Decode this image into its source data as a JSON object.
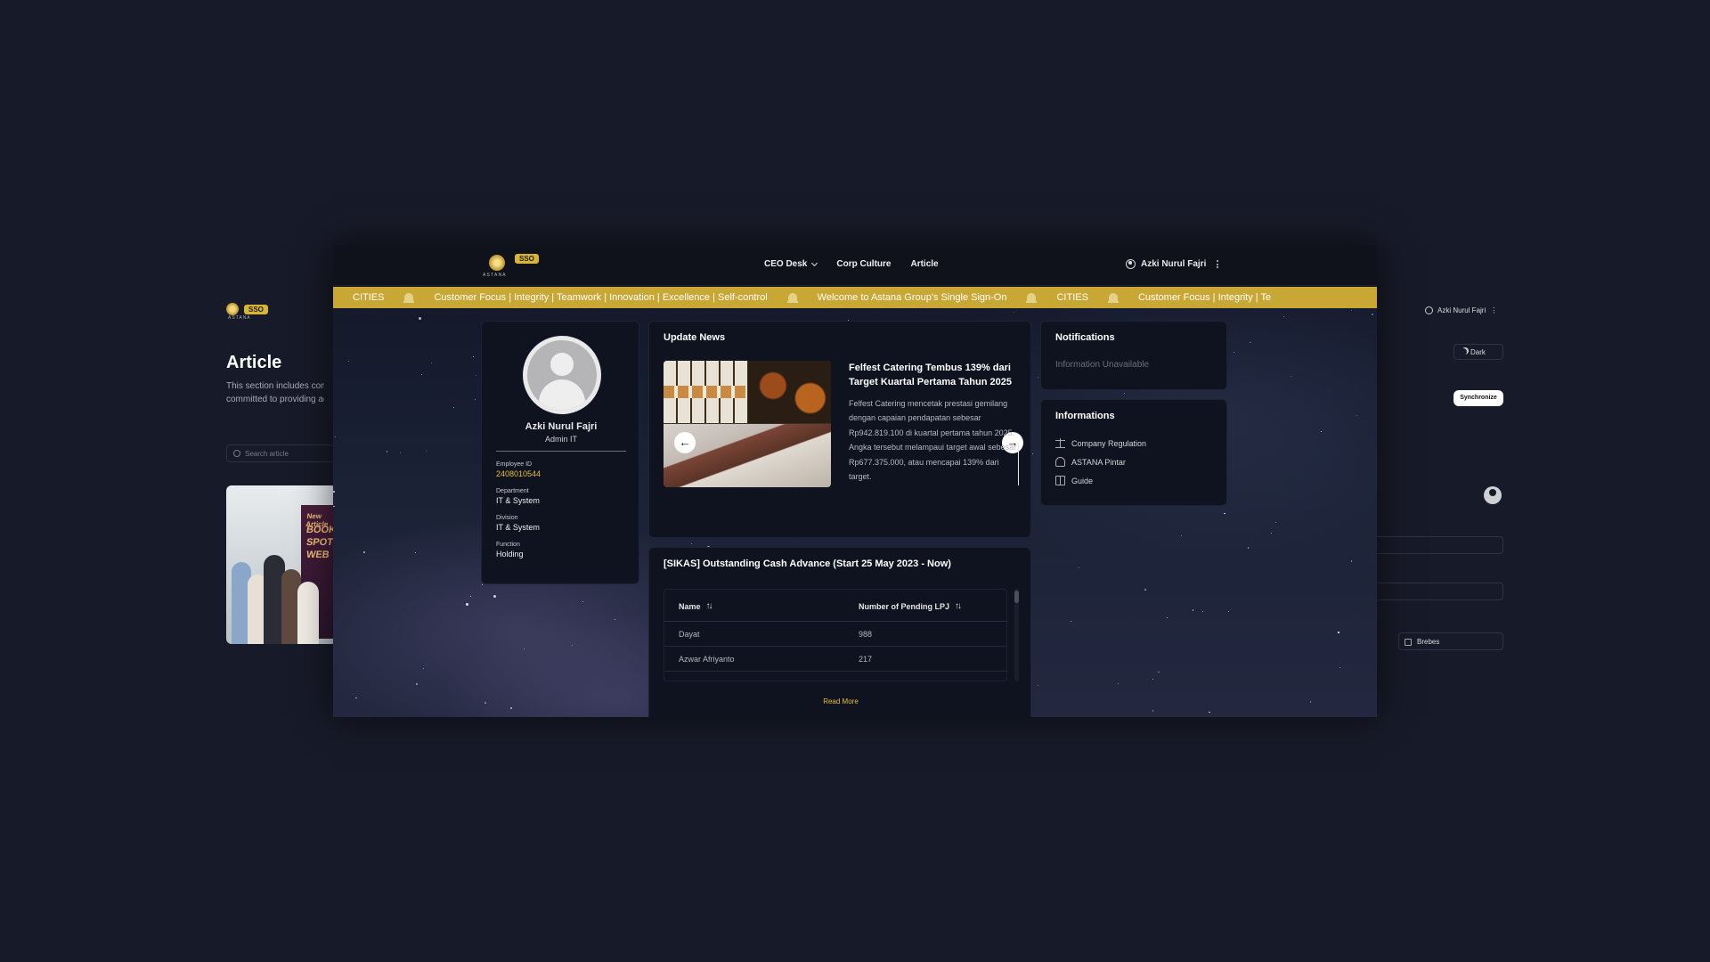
{
  "background_page": {
    "sso_badge": "SSO",
    "logo_text": "ASTANA",
    "title": "Article",
    "description_line1": "This section includes comp",
    "description_line2": "committed to providing ac",
    "search_placeholder": "Search article",
    "poster_words": [
      "New Article",
      "BOOK",
      "SPOT",
      "WEB"
    ],
    "user_name": "Azki Nurul Fajri",
    "theme_label": "Dark",
    "sync_label": "Synchronize",
    "location_label": "Brebes"
  },
  "app": {
    "logo_text": "ASTANA",
    "sso_badge": "SSO",
    "nav": [
      {
        "label": "CEO Desk",
        "has_dropdown": true
      },
      {
        "label": "Corp Culture"
      },
      {
        "label": "Article"
      }
    ],
    "user_name": "Azki Nurul Fajri"
  },
  "ticker": {
    "segments": [
      "CITIES",
      "Customer Focus | Integrity | Teamwork | Innovation | Excellence | Self-control",
      "Welcome to Astana Group's Single Sign-On",
      "CITIES",
      "Customer Focus | Integrity | Te"
    ],
    "bg_color": "#c9a735"
  },
  "profile": {
    "name": "Azki Nurul Fajri",
    "role": "Admin IT",
    "employee_id_label": "Employee ID",
    "employee_id": "2408010544",
    "department_label": "Department",
    "department": "IT & System",
    "division_label": "Division",
    "division": "IT & System",
    "function_label": "Function",
    "function": "Holding"
  },
  "news": {
    "title": "Update News",
    "headline": "Felfest Catering Tembus 139% dari Target Kuartal Pertama Tahun 2025",
    "body": "Felfest Catering mencetak prestasi gemilang dengan capaian pendapatan sebesar Rp942.819.100 di kuartal pertama tahun 2025. Angka tersebut melampaui target awal sebesar Rp677.375.000, atau mencapai 139% dari target.",
    "prev_symbol": "←",
    "next_symbol": "→"
  },
  "sikas": {
    "title": "[SIKAS] Outstanding Cash Advance (Start 25 May 2023 - Now)",
    "col_name": "Name",
    "col_pending": "Number of Pending LPJ",
    "rows": [
      {
        "name": "Dayat",
        "pending": "988"
      },
      {
        "name": "Azwar Afriyanto",
        "pending": "217"
      }
    ],
    "read_more": "Read More"
  },
  "notifications": {
    "title": "Notifications",
    "empty_text": "Information Unavailable"
  },
  "informations": {
    "title": "Informations",
    "items": [
      {
        "label": "Company Regulation",
        "icon": "scale-icon"
      },
      {
        "label": "ASTANA Pintar",
        "icon": "graduation-cap-icon"
      },
      {
        "label": "Guide",
        "icon": "book-icon"
      }
    ]
  },
  "colors": {
    "accent": "#e6be3c",
    "page_bg": "#171a28",
    "card_bg": "#0f1320"
  }
}
